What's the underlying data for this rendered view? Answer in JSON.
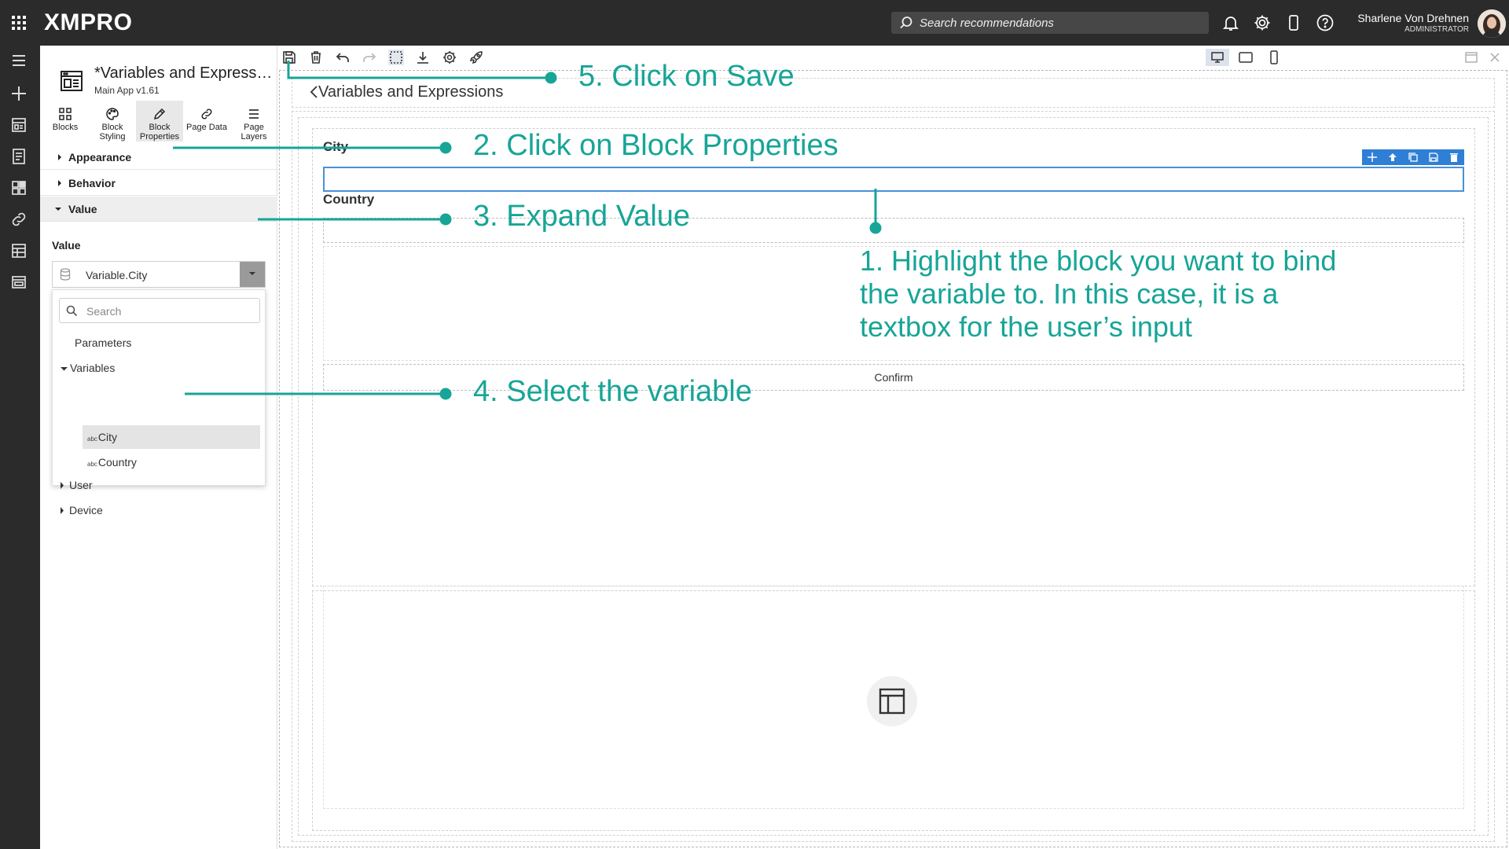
{
  "topbar": {
    "logo": "XMPRO",
    "search_placeholder": "Search recommendations",
    "user_name": "Sharlene Von Drehnen",
    "user_role": "ADMINISTRATOR",
    "icons": [
      "apps-grid-icon",
      "bell-icon",
      "gear-icon",
      "mobile-icon",
      "help-icon"
    ]
  },
  "rail": {
    "icons": [
      "menu-icon",
      "add-icon",
      "app-icon",
      "notebook-icon",
      "dashboard-icon",
      "link-icon",
      "table-icon",
      "window-icon",
      "xmpro-x-icon"
    ],
    "brand_mark": "X"
  },
  "panel": {
    "title": "*Variables and Expressions",
    "subtitle": "Main App v1.61",
    "tabs": [
      {
        "line1": "Blocks",
        "line2": ""
      },
      {
        "line1": "Block",
        "line2": "Styling"
      },
      {
        "line1": "Block",
        "line2": "Properties"
      },
      {
        "line1": "Page Data",
        "line2": ""
      },
      {
        "line1": "Page",
        "line2": "Layers"
      }
    ],
    "active_tab": "Block Properties",
    "sections": [
      "Appearance",
      "Behavior",
      "Value"
    ],
    "value_label": "Value",
    "value_selected": "Variable.City",
    "dropdown": {
      "search_placeholder": "Search",
      "items": {
        "parameters": "Parameters",
        "variables": "Variables",
        "city_prefix": "abc",
        "city": "City",
        "country_prefix": "abc",
        "country": "Country",
        "user": "User",
        "device": "Device"
      }
    }
  },
  "canvas": {
    "page_title": "Variables and Expressions",
    "city_label": "City",
    "country_label": "Country",
    "confirm_label": "Confirm",
    "toolbar_icons": [
      "save-icon",
      "delete-icon",
      "undo-icon",
      "redo-icon",
      "select-icon",
      "download-icon",
      "settings-icon",
      "rocket-icon"
    ],
    "device_icons": [
      "desktop-icon",
      "tablet-icon",
      "phone-icon"
    ]
  },
  "annotations": {
    "step1": "1. Highlight the block you want to bind the variable to. In this case, it is a textbox for the user’s input",
    "step2": "2. Click on Block Properties",
    "step3": "3. Expand Value",
    "step4": "4. Select the variable",
    "step5": "5. Click on Save",
    "color": "#17a597"
  },
  "colors": {
    "topbar": "#2b2b2b",
    "accent": "#00a99d",
    "selection_blue": "#2f7fd6"
  }
}
